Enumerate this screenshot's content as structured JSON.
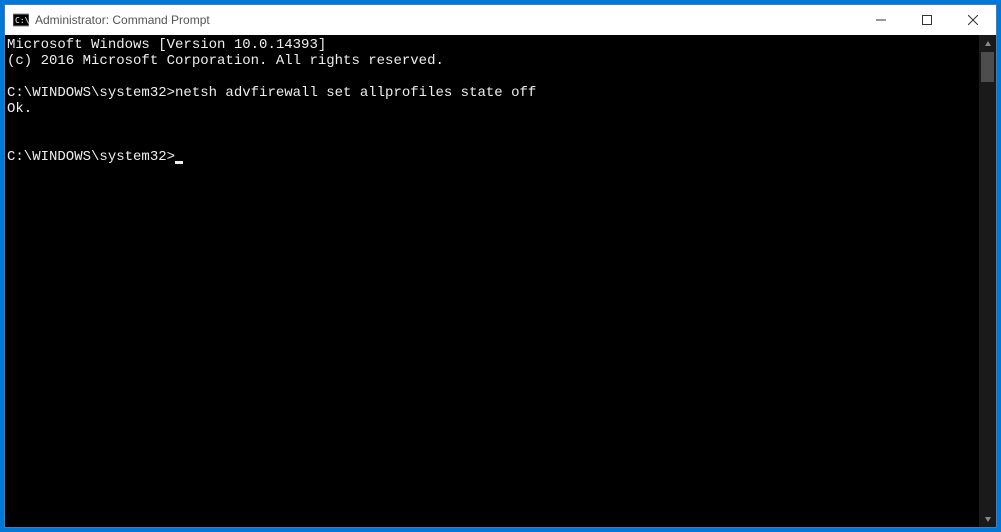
{
  "window": {
    "title": "Administrator: Command Prompt"
  },
  "terminal": {
    "lines": [
      "Microsoft Windows [Version 10.0.14393]",
      "(c) 2016 Microsoft Corporation. All rights reserved.",
      "",
      "C:\\WINDOWS\\system32>netsh advfirewall set allprofiles state off",
      "Ok.",
      "",
      ""
    ],
    "prompt": "C:\\WINDOWS\\system32>"
  }
}
